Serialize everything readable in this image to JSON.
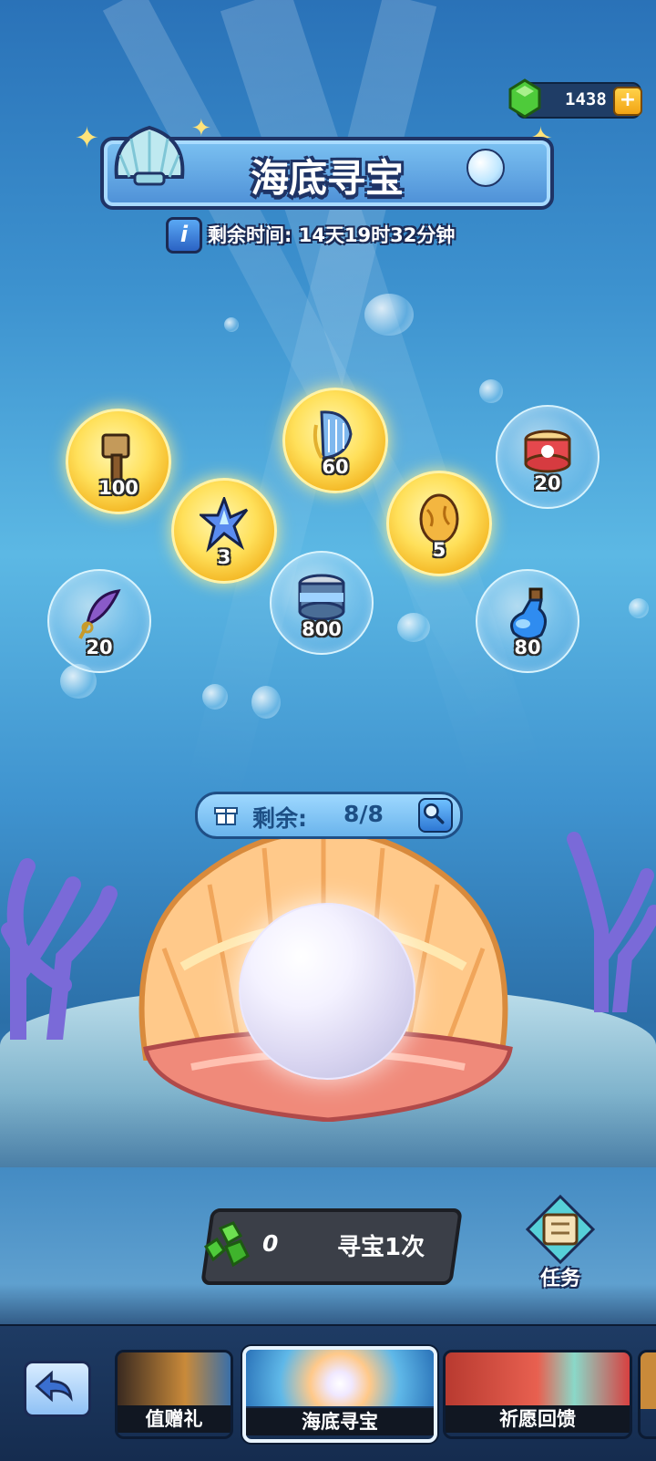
{
  "currency": {
    "icon": "green-gem-icon",
    "value": "1438",
    "add_label": "+"
  },
  "header": {
    "title": "海底寻宝",
    "info_label": "i",
    "timer": "剩余时间: 14天19时32分钟"
  },
  "rewards": [
    {
      "icon": "hammer-icon",
      "quantity": "100",
      "style": "gold"
    },
    {
      "icon": "harp-icon",
      "quantity": "60",
      "style": "gold"
    },
    {
      "icon": "canned-food-icon",
      "quantity": "20",
      "style": "bubble"
    },
    {
      "icon": "crystal-shard-icon",
      "quantity": "3",
      "style": "gold"
    },
    {
      "icon": "egg-icon",
      "quantity": "5",
      "style": "gold"
    },
    {
      "icon": "feather-key-icon",
      "quantity": "20",
      "style": "bubble"
    },
    {
      "icon": "tin-can-icon",
      "quantity": "800",
      "style": "bubble"
    },
    {
      "icon": "potion-bottle-icon",
      "quantity": "80",
      "style": "bubble"
    }
  ],
  "remaining": {
    "label": "剩余:",
    "value": "8/8"
  },
  "action": {
    "cost": "0",
    "label": "寻宝1次"
  },
  "task": {
    "label": "任务"
  },
  "bottom_tabs": [
    {
      "label": "值赠礼"
    },
    {
      "label": "海底寻宝"
    },
    {
      "label": "祈愿回馈"
    }
  ],
  "colors": {
    "accent": "#1f3466",
    "gold": "#ffd24a",
    "gem": "#4ecb3a"
  }
}
